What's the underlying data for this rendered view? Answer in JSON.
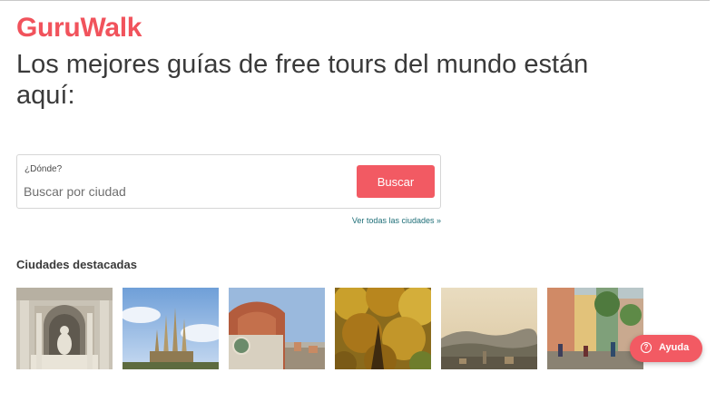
{
  "brand": {
    "logo": "GuruWalk",
    "color": "#f1535c"
  },
  "headline": "Los mejores guías de free tours del mundo están aquí:",
  "search": {
    "caption": "¿Dónde?",
    "placeholder": "Buscar por ciudad",
    "button_label": "Buscar"
  },
  "all_cities_link": "Ver todas las ciudades »",
  "featured": {
    "title": "Ciudades destacadas",
    "cities": [
      {
        "icon": "fountain-monument-photo"
      },
      {
        "icon": "basilica-spires-photo"
      },
      {
        "icon": "cathedral-dome-photo"
      },
      {
        "icon": "autumn-trees-photo"
      },
      {
        "icon": "hilltop-city-photo"
      },
      {
        "icon": "street-market-photo"
      }
    ]
  },
  "help": {
    "label": "Ayuda",
    "icon": "question-icon"
  }
}
